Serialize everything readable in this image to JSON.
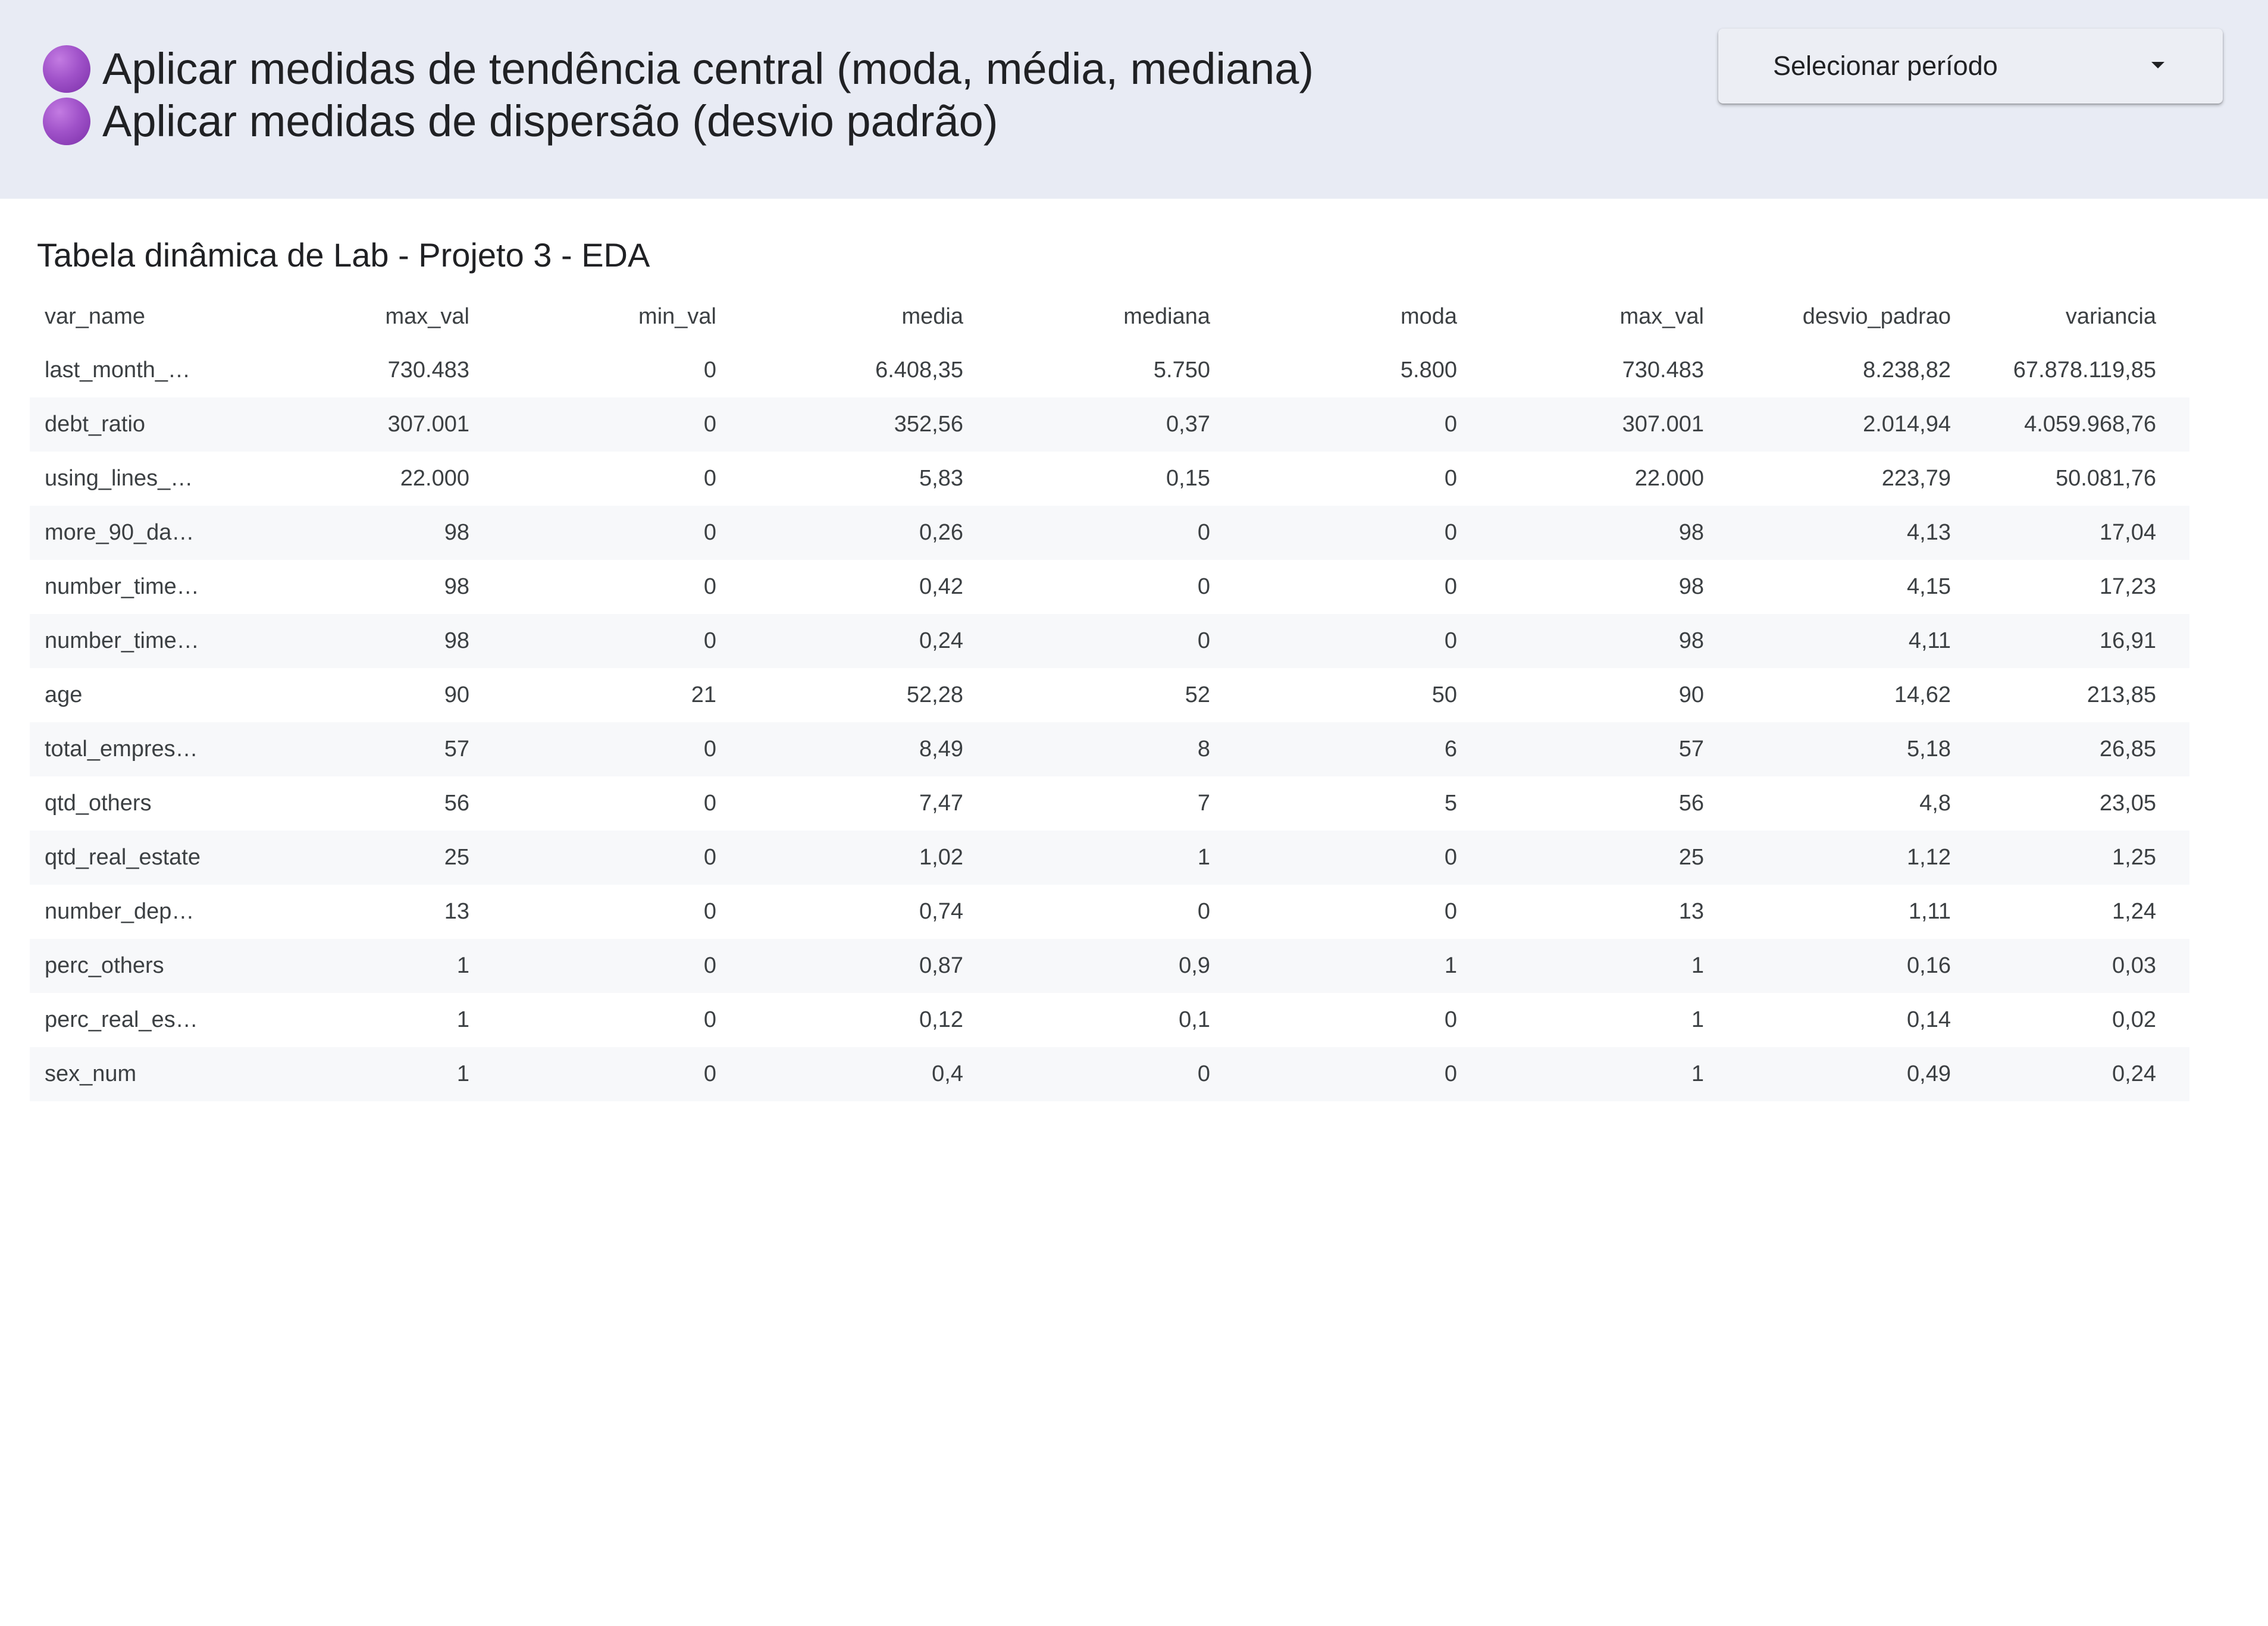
{
  "header": {
    "bullets": [
      "Aplicar medidas de tendência central (moda, média, mediana)",
      "Aplicar medidas de dispersão (desvio padrão)"
    ],
    "bullet_color": "#a052c9",
    "background": "#e8ebf4"
  },
  "period_selector": {
    "label": "Selecionar período"
  },
  "table": {
    "title": "Tabela dinâmica de Lab - Projeto 3 - EDA",
    "columns": [
      "var_name",
      "max_val",
      "min_val",
      "media",
      "mediana",
      "moda",
      "max_val",
      "desvio_padrao",
      "variancia"
    ],
    "rows": [
      [
        "last_month_…",
        "730.483",
        "0",
        "6.408,35",
        "5.750",
        "5.800",
        "730.483",
        "8.238,82",
        "67.878.119,85"
      ],
      [
        "debt_ratio",
        "307.001",
        "0",
        "352,56",
        "0,37",
        "0",
        "307.001",
        "2.014,94",
        "4.059.968,76"
      ],
      [
        "using_lines_…",
        "22.000",
        "0",
        "5,83",
        "0,15",
        "0",
        "22.000",
        "223,79",
        "50.081,76"
      ],
      [
        "more_90_da…",
        "98",
        "0",
        "0,26",
        "0",
        "0",
        "98",
        "4,13",
        "17,04"
      ],
      [
        "number_time…",
        "98",
        "0",
        "0,42",
        "0",
        "0",
        "98",
        "4,15",
        "17,23"
      ],
      [
        "number_time…",
        "98",
        "0",
        "0,24",
        "0",
        "0",
        "98",
        "4,11",
        "16,91"
      ],
      [
        "age",
        "90",
        "21",
        "52,28",
        "52",
        "50",
        "90",
        "14,62",
        "213,85"
      ],
      [
        "total_empres…",
        "57",
        "0",
        "8,49",
        "8",
        "6",
        "57",
        "5,18",
        "26,85"
      ],
      [
        "qtd_others",
        "56",
        "0",
        "7,47",
        "7",
        "5",
        "56",
        "4,8",
        "23,05"
      ],
      [
        "qtd_real_estate",
        "25",
        "0",
        "1,02",
        "1",
        "0",
        "25",
        "1,12",
        "1,25"
      ],
      [
        "number_dep…",
        "13",
        "0",
        "0,74",
        "0",
        "0",
        "13",
        "1,11",
        "1,24"
      ],
      [
        "perc_others",
        "1",
        "0",
        "0,87",
        "0,9",
        "1",
        "1",
        "0,16",
        "0,03"
      ],
      [
        "perc_real_es…",
        "1",
        "0",
        "0,12",
        "0,1",
        "0",
        "1",
        "0,14",
        "0,02"
      ],
      [
        "sex_num",
        "1",
        "0",
        "0,4",
        "0",
        "0",
        "1",
        "0,49",
        "0,24"
      ]
    ]
  }
}
